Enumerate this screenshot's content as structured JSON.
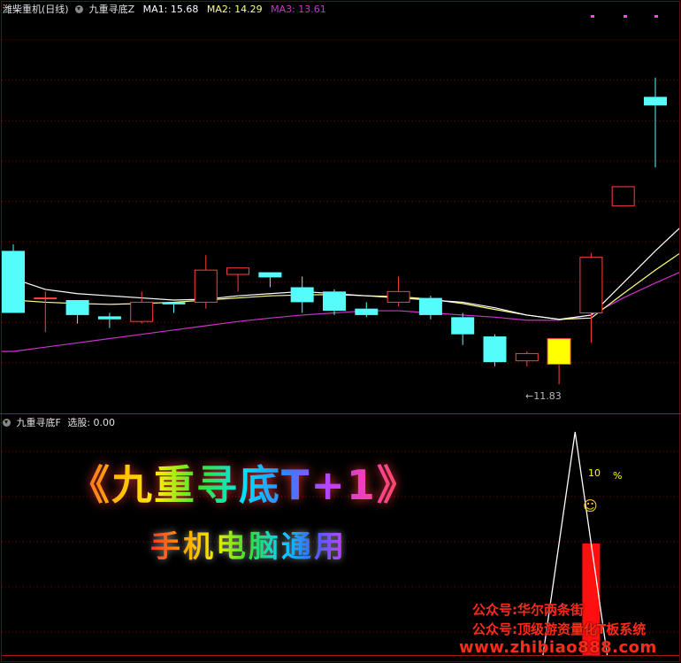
{
  "header": {
    "stock_name": "潍柴重机(日线)",
    "indicator_name": "九重寻底Z",
    "ma1": "MA1: 15.68",
    "ma2": "MA2: 14.29",
    "ma3": "MA3: 13.61"
  },
  "sub_header": {
    "indicator_name": "九重寻底F",
    "select_label": "选股: 0.00"
  },
  "annotations": {
    "low_price": "←11.83",
    "percent_value": "10",
    "percent_sign": "%",
    "smiley": "☺"
  },
  "banner": {
    "title": "《九重寻底T+1》",
    "subtitle": "手机电脑通用"
  },
  "watermark": {
    "line1": "公众号:华尔两条街",
    "line2": "公众号:顶级游资量化T板系统",
    "line3": "www.zhibiao888.com"
  },
  "colors": {
    "up": "#ff4040",
    "down": "#54fcfc",
    "signal": "#ffff00",
    "ma1": "#ffffff",
    "ma2": "#ffff80",
    "ma3": "#cc33cc",
    "grid": "#8b0000"
  },
  "chart_data": [
    {
      "type": "candlestick",
      "title": "潍柴重机(日线)",
      "candles": [
        {
          "o": 14.95,
          "h": 15.1,
          "l": 13.5,
          "c": 13.5
        },
        {
          "o": 13.85,
          "h": 14.0,
          "l": 13.05,
          "c": 13.85
        },
        {
          "o": 13.8,
          "h": 13.8,
          "l": 13.25,
          "c": 13.45
        },
        {
          "o": 13.42,
          "h": 13.5,
          "l": 13.15,
          "c": 13.35
        },
        {
          "o": 13.3,
          "h": 14.0,
          "l": 13.25,
          "c": 13.75
        },
        {
          "o": 13.75,
          "h": 13.75,
          "l": 13.5,
          "c": 13.7
        },
        {
          "o": 13.75,
          "h": 14.85,
          "l": 13.6,
          "c": 14.5
        },
        {
          "o": 14.4,
          "h": 14.55,
          "l": 14.0,
          "c": 14.55
        },
        {
          "o": 14.45,
          "h": 14.45,
          "l": 14.1,
          "c": 14.33
        },
        {
          "o": 14.1,
          "h": 14.35,
          "l": 13.5,
          "c": 13.75
        },
        {
          "o": 14.0,
          "h": 14.05,
          "l": 13.45,
          "c": 13.55
        },
        {
          "o": 13.6,
          "h": 13.75,
          "l": 13.4,
          "c": 13.45
        },
        {
          "o": 13.75,
          "h": 14.35,
          "l": 13.65,
          "c": 14.0
        },
        {
          "o": 13.85,
          "h": 13.9,
          "l": 13.35,
          "c": 13.45
        },
        {
          "o": 13.4,
          "h": 13.5,
          "l": 12.75,
          "c": 13.0
        },
        {
          "o": 12.95,
          "h": 13.0,
          "l": 12.25,
          "c": 12.35
        },
        {
          "o": 12.38,
          "h": 12.6,
          "l": 12.25,
          "c": 12.55
        },
        {
          "o": 12.3,
          "h": 12.9,
          "l": 11.83,
          "c": 12.9
        },
        {
          "o": 13.5,
          "h": 14.9,
          "l": 12.8,
          "c": 14.8
        },
        {
          "o": 16.0,
          "h": 16.45,
          "l": 16.0,
          "c": 16.45
        },
        {
          "o": 18.55,
          "h": 19.0,
          "l": 16.9,
          "c": 18.35
        }
      ],
      "signal_candle_index": 17,
      "ma1": [
        14.3,
        14.05,
        13.95,
        13.9,
        13.85,
        13.8,
        13.82,
        13.9,
        13.95,
        14.0,
        13.95,
        13.9,
        13.85,
        13.8,
        13.75,
        13.62,
        13.45,
        13.35,
        13.45,
        14.2,
        14.95
      ],
      "ma2": [
        13.8,
        13.75,
        13.72,
        13.7,
        13.72,
        13.75,
        13.8,
        13.85,
        13.9,
        13.92,
        13.93,
        13.9,
        13.88,
        13.82,
        13.72,
        13.58,
        13.45,
        13.35,
        13.38,
        13.95,
        14.5
      ],
      "ma3": [
        12.6,
        12.7,
        12.8,
        12.9,
        13.0,
        13.1,
        13.2,
        13.3,
        13.38,
        13.45,
        13.5,
        13.55,
        13.55,
        13.5,
        13.45,
        13.4,
        13.33,
        13.33,
        13.45,
        13.85,
        14.2
      ],
      "ylim": [
        11.4,
        20.4
      ]
    },
    {
      "type": "bar",
      "title": "九重寻底F",
      "bars": [
        {
          "index": 18,
          "value": 10
        }
      ],
      "line": [
        {
          "index": 16.5,
          "value": 0
        },
        {
          "index": 17.5,
          "value": 20
        },
        {
          "index": 18.5,
          "value": 0
        }
      ],
      "ylim": [
        0,
        20
      ]
    }
  ]
}
